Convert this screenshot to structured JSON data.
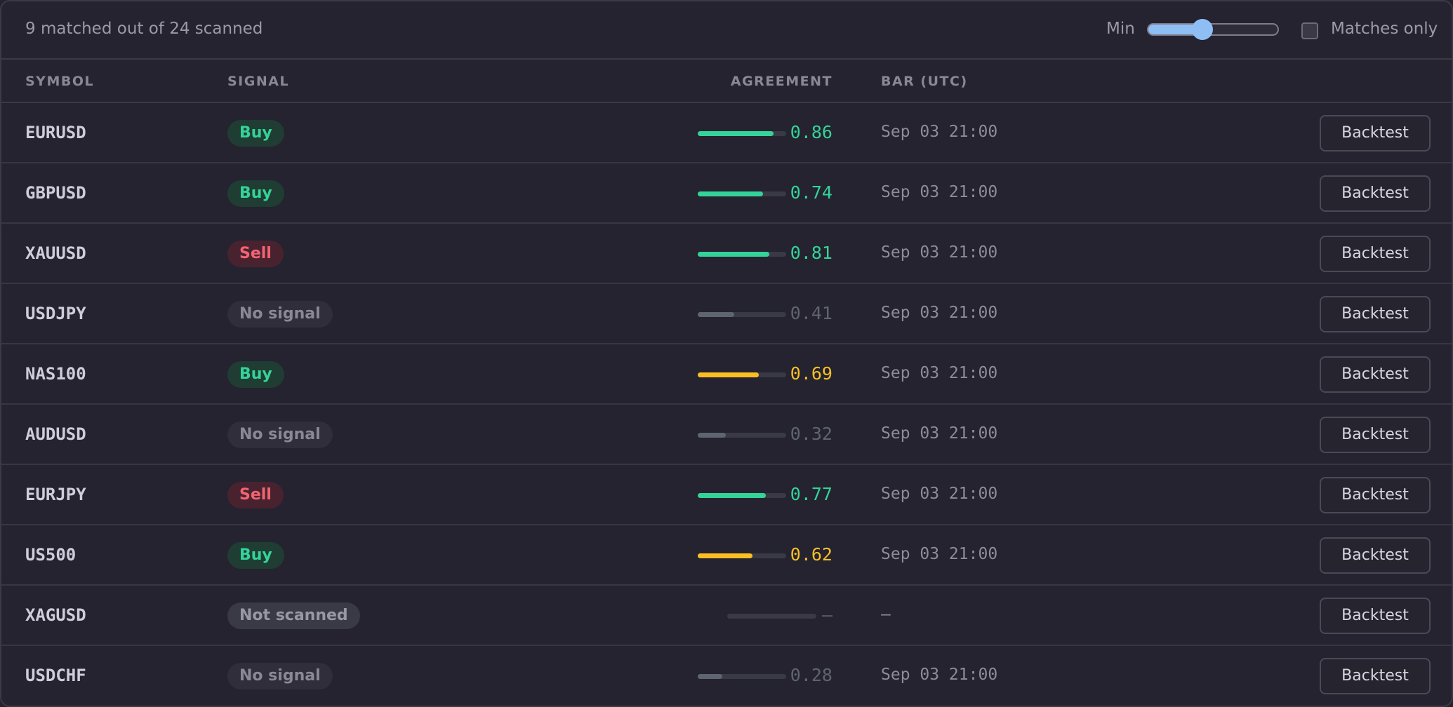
{
  "toolbar": {
    "summary": "9 matched out of 24 scanned",
    "min_label": "Min",
    "min_value": 0.42,
    "matches_only_label": "Matches only",
    "matches_only_checked": false
  },
  "columns": {
    "symbol": "SYMBOL",
    "signal": "SIGNAL",
    "agreement": "AGREEMENT",
    "bar": "BAR (UTC)"
  },
  "colors": {
    "green": "#34d399",
    "amber": "#fbbf24",
    "gray": "#5f6471",
    "sell": "#f26472",
    "accent": "#8fbef5"
  },
  "rows": [
    {
      "symbol": "EURUSD",
      "signal": "Buy",
      "kind": "buy",
      "agreement": 0.86,
      "score": "0.86",
      "tone": "green",
      "bar": "Sep 03 21:00",
      "action": "Backtest"
    },
    {
      "symbol": "GBPUSD",
      "signal": "Buy",
      "kind": "buy",
      "agreement": 0.74,
      "score": "0.74",
      "tone": "green",
      "bar": "Sep 03 21:00",
      "action": "Backtest"
    },
    {
      "symbol": "XAUUSD",
      "signal": "Sell",
      "kind": "sell",
      "agreement": 0.81,
      "score": "0.81",
      "tone": "green",
      "bar": "Sep 03 21:00",
      "action": "Backtest"
    },
    {
      "symbol": "USDJPY",
      "signal": "No signal",
      "kind": "none",
      "agreement": 0.41,
      "score": "0.41",
      "tone": "gray",
      "bar": "Sep 03 21:00",
      "action": "Backtest"
    },
    {
      "symbol": "NAS100",
      "signal": "Buy",
      "kind": "buy",
      "agreement": 0.69,
      "score": "0.69",
      "tone": "amber",
      "bar": "Sep 03 21:00",
      "action": "Backtest"
    },
    {
      "symbol": "AUDUSD",
      "signal": "No signal",
      "kind": "none",
      "agreement": 0.32,
      "score": "0.32",
      "tone": "gray",
      "bar": "Sep 03 21:00",
      "action": "Backtest"
    },
    {
      "symbol": "EURJPY",
      "signal": "Sell",
      "kind": "sell",
      "agreement": 0.77,
      "score": "0.77",
      "tone": "green",
      "bar": "Sep 03 21:00",
      "action": "Backtest"
    },
    {
      "symbol": "US500",
      "signal": "Buy",
      "kind": "buy",
      "agreement": 0.62,
      "score": "0.62",
      "tone": "amber",
      "bar": "Sep 03 21:00",
      "action": "Backtest"
    },
    {
      "symbol": "XAGUSD",
      "signal": "Not scanned",
      "kind": "notscanned",
      "agreement": null,
      "score": "—",
      "tone": "gray",
      "bar": "—",
      "action": "Backtest"
    },
    {
      "symbol": "USDCHF",
      "signal": "No signal",
      "kind": "none",
      "agreement": 0.28,
      "score": "0.28",
      "tone": "gray",
      "bar": "Sep 03 21:00",
      "action": "Backtest"
    }
  ]
}
